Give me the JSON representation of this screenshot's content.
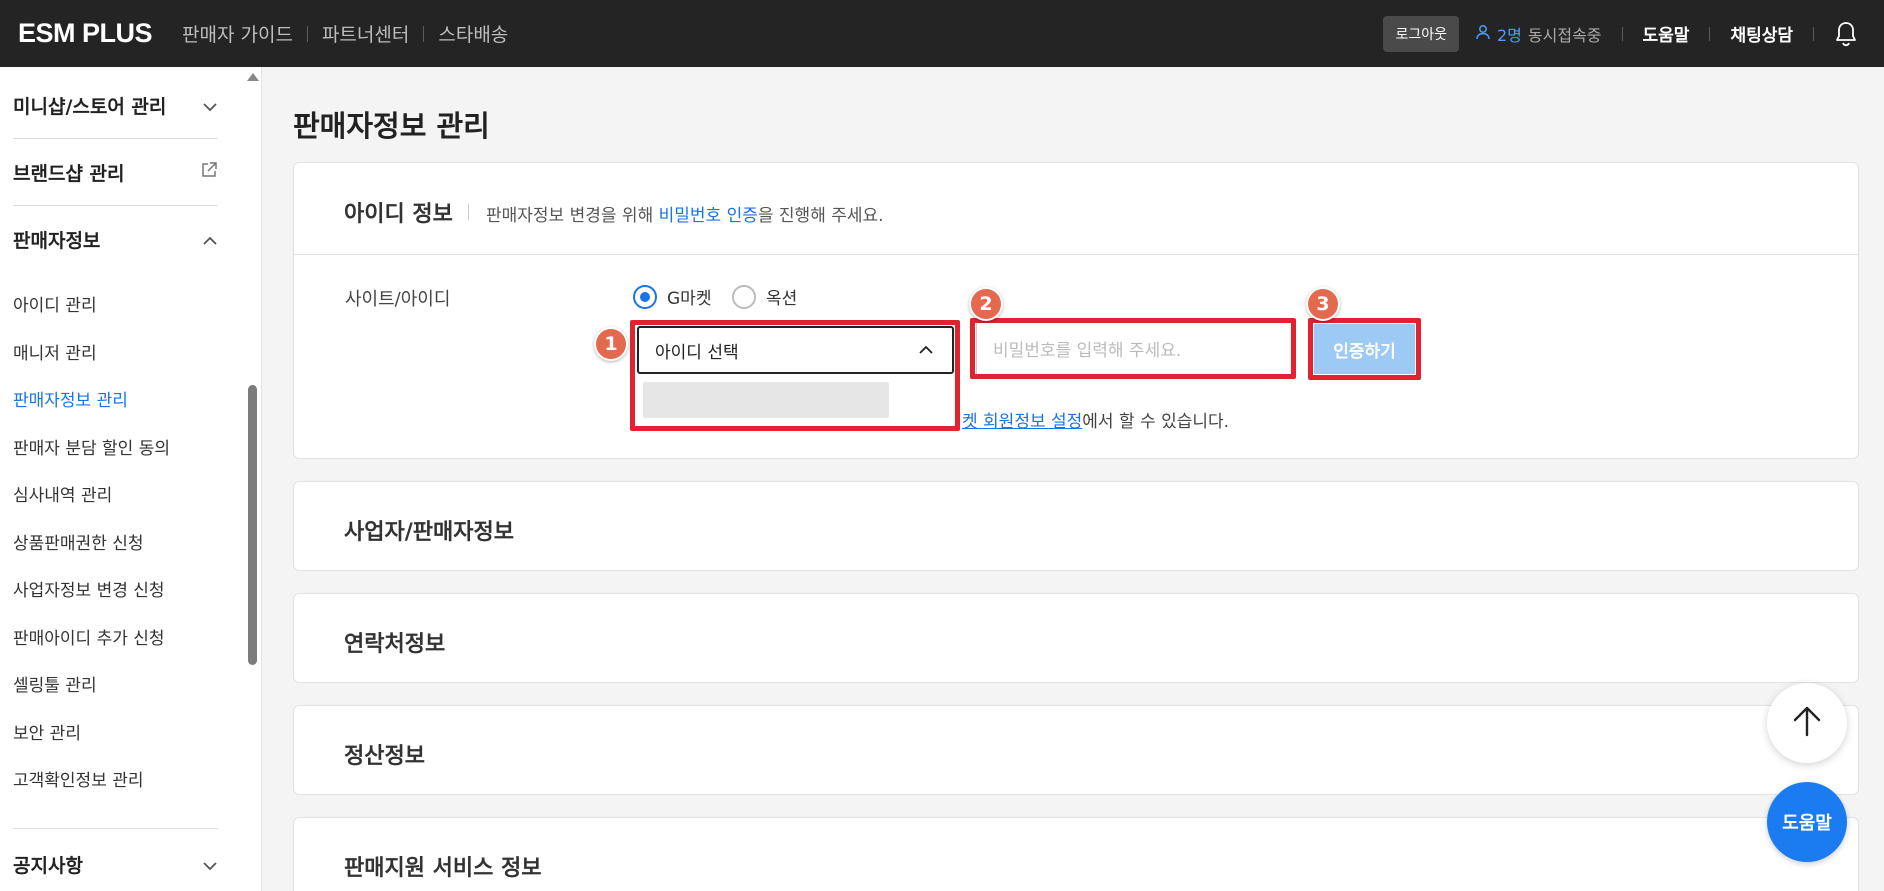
{
  "topbar": {
    "logo": "ESM PLUS",
    "nav": [
      "판매자 가이드",
      "파트너센터",
      "스타배송"
    ],
    "logout": "로그아웃",
    "user_count": "2명",
    "user_label": "동시접속중",
    "help": "도움말",
    "chat": "채팅상담"
  },
  "sidebar": {
    "groups": [
      {
        "label": "미니샵/스토어 관리",
        "icon": "chevron-down-icon"
      },
      {
        "label": "브랜드샵 관리",
        "icon": "external-link-icon"
      },
      {
        "label": "판매자정보",
        "icon": "chevron-up-icon"
      },
      {
        "label": "공지사항",
        "icon": "chevron-down-icon"
      }
    ],
    "items": [
      {
        "label": "아이디 관리",
        "active": false
      },
      {
        "label": "매니저 관리",
        "active": false
      },
      {
        "label": "판매자정보 관리",
        "active": true
      },
      {
        "label": "판매자 분담 할인 동의",
        "active": false
      },
      {
        "label": "심사내역 관리",
        "active": false
      },
      {
        "label": "상품판매권한 신청",
        "active": false
      },
      {
        "label": "사업자정보 변경 신청",
        "active": false
      },
      {
        "label": "판매아이디 추가 신청",
        "active": false
      },
      {
        "label": "셀링툴 관리",
        "active": false
      },
      {
        "label": "보안 관리",
        "active": false
      },
      {
        "label": "고객확인정보 관리",
        "active": false
      }
    ]
  },
  "main": {
    "page_title": "판매자정보 관리",
    "id_info": {
      "title": "아이디 정보",
      "desc_before": "판매자정보 변경을 위해 ",
      "desc_link": "비밀번호 인증",
      "desc_after": "을 진행해 주세요.",
      "site_label": "사이트/아이디",
      "radios": [
        {
          "label": "G마켓",
          "checked": true
        },
        {
          "label": "옥션",
          "checked": false
        }
      ],
      "id_select": "아이디 선택",
      "pw_placeholder": "비밀번호를 입력해 주세요.",
      "auth_button": "인증하기",
      "note_link": "켓 회원정보 설정",
      "note_after": "에서 할 수 있습니다."
    },
    "sections": [
      "사업자/판매자정보",
      "연락처정보",
      "정산정보",
      "판매지원 서비스 정보"
    ],
    "annotations": [
      "1",
      "2",
      "3"
    ]
  },
  "floating": {
    "help": "도움말"
  },
  "colors": {
    "accent": "#1a73e8",
    "highlight_box": "#e0232e",
    "badge": "#e36a4e",
    "auth_button": "#9ccaf5",
    "topbar": "#242424"
  }
}
